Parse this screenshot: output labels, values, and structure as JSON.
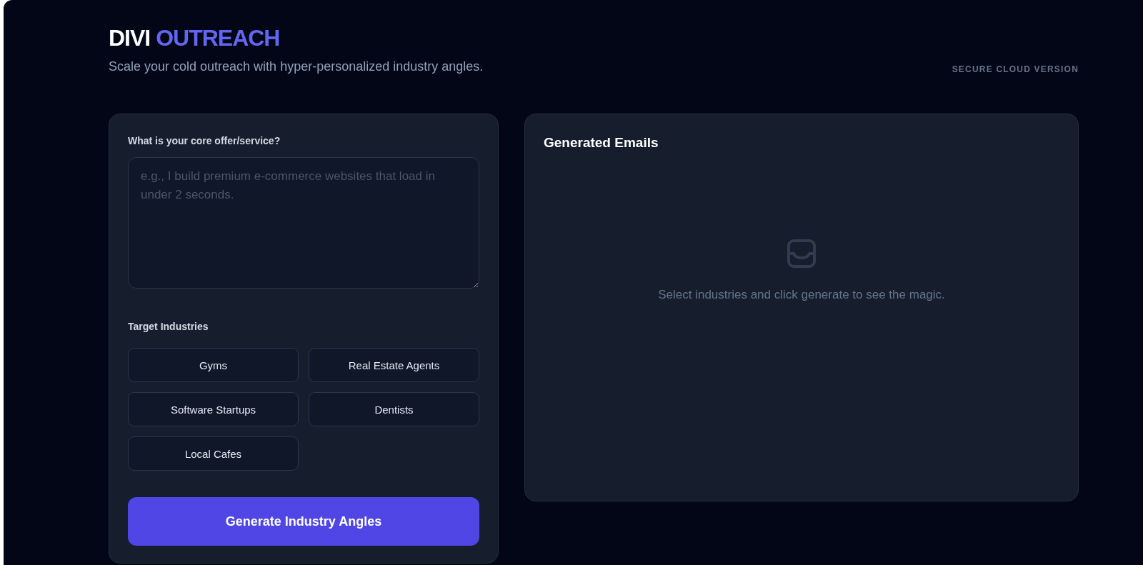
{
  "header": {
    "brand": [
      {
        "text": "DIVI",
        "kind": "plain"
      },
      {
        "text": "OUTREACH",
        "kind": "accent"
      }
    ],
    "tagline": "Scale your cold outreach with hyper-personalized industry angles.",
    "badge": "SECURE CLOUD VERSION"
  },
  "offer_form": {
    "label": "What is your core offer/service?",
    "placeholder": "e.g., I build premium e-commerce websites that load in under 2 seconds.",
    "industries_label": "Target Industries",
    "industries": [
      {
        "label": "Gyms",
        "selected": false
      },
      {
        "label": "Real Estate Agents",
        "selected": false
      },
      {
        "label": "Software Startups",
        "selected": false
      },
      {
        "label": "Dentists",
        "selected": false
      },
      {
        "label": "Local Cafes",
        "selected": false
      }
    ],
    "generate_button": "Generate Industry Angles"
  },
  "results": {
    "title": "Generated Emails",
    "empty_message": "Select industries and click generate to see the magic."
  }
}
